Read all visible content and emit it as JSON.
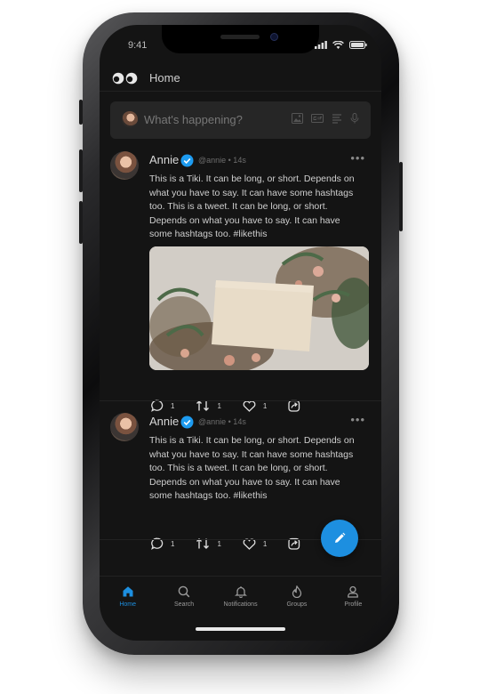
{
  "status": {
    "time": "9:41"
  },
  "header": {
    "title": "Home"
  },
  "composer": {
    "placeholder": "What's happening?"
  },
  "tweets": [
    {
      "name": "Annie",
      "handle": "@annie",
      "time": "14s",
      "meta": "@annie • 14s",
      "text": "This is a Tiki. It can be long, or short. Depends on what you have to say. It can have some hashtags too. This is a tweet. It can be long, or short. Depends on what you have to say. It can have some hashtags too. #likethis",
      "replies": "1",
      "retweets": "1",
      "likes": "1",
      "has_image": true
    },
    {
      "name": "Annie",
      "handle": "@annie",
      "time": "14s",
      "meta": "@annie • 14s",
      "text": "This is a Tiki. It can be long, or short. Depends on what you have to say. It can have some hashtags too. This is a tweet. It can be long, or short. Depends on what you have to say. It can have some hashtags too. #likethis",
      "replies": "1",
      "retweets": "1",
      "likes": "1",
      "has_image": false
    }
  ],
  "tabs": [
    {
      "label": "Home",
      "icon": "home-icon",
      "active": true
    },
    {
      "label": "Search",
      "icon": "search-icon",
      "active": false
    },
    {
      "label": "Notifications",
      "icon": "bell-icon",
      "active": false
    },
    {
      "label": "Groups",
      "icon": "flame-icon",
      "active": false
    },
    {
      "label": "Profile",
      "icon": "user-icon",
      "active": false
    }
  ],
  "colors": {
    "accent": "#1d8fe0",
    "background": "#141414",
    "verified": "#1d9bf0"
  }
}
